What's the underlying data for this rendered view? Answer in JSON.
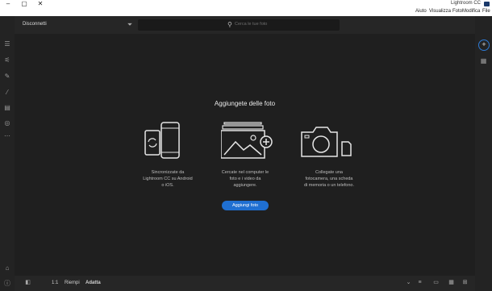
{
  "window": {
    "title": "Lightroom CC",
    "minimize": "–",
    "maximize": "▢",
    "close": "✕"
  },
  "menu": {
    "items": [
      "File",
      "Modifica",
      "Foto",
      "Visualizza",
      "Aiuto"
    ]
  },
  "toolbar": {
    "disconnect_label": "Disconnetti",
    "search_placeholder": "Cerca le tue foto",
    "logo": "Lr"
  },
  "empty_state": {
    "heading": "Aggiungete delle foto",
    "add_button": "Aggiungi foto",
    "captions": {
      "camera": [
        "Collegate una",
        "fotocamera, una scheda",
        "di memoria o un telefono."
      ],
      "photos": [
        "Cercate nel computer le",
        "foto e i video da",
        "aggiungere."
      ],
      "phone": [
        "Sincronizzate da",
        "Lightroom CC su Android",
        "o iOS."
      ]
    }
  },
  "bottom": {
    "fit_label": "Adatta",
    "fill_label": "Riempi",
    "ratio_label": "1:1"
  },
  "colors": {
    "accent": "#1f6fd1"
  },
  "icons": {
    "left": [
      "library-icon",
      "edit-sliders-icon",
      "healing-brush-icon",
      "brush-icon",
      "gradient-icon",
      "radial-icon",
      "more-icon"
    ],
    "right": [
      "add-photos-icon",
      "grid-view-icon"
    ]
  }
}
